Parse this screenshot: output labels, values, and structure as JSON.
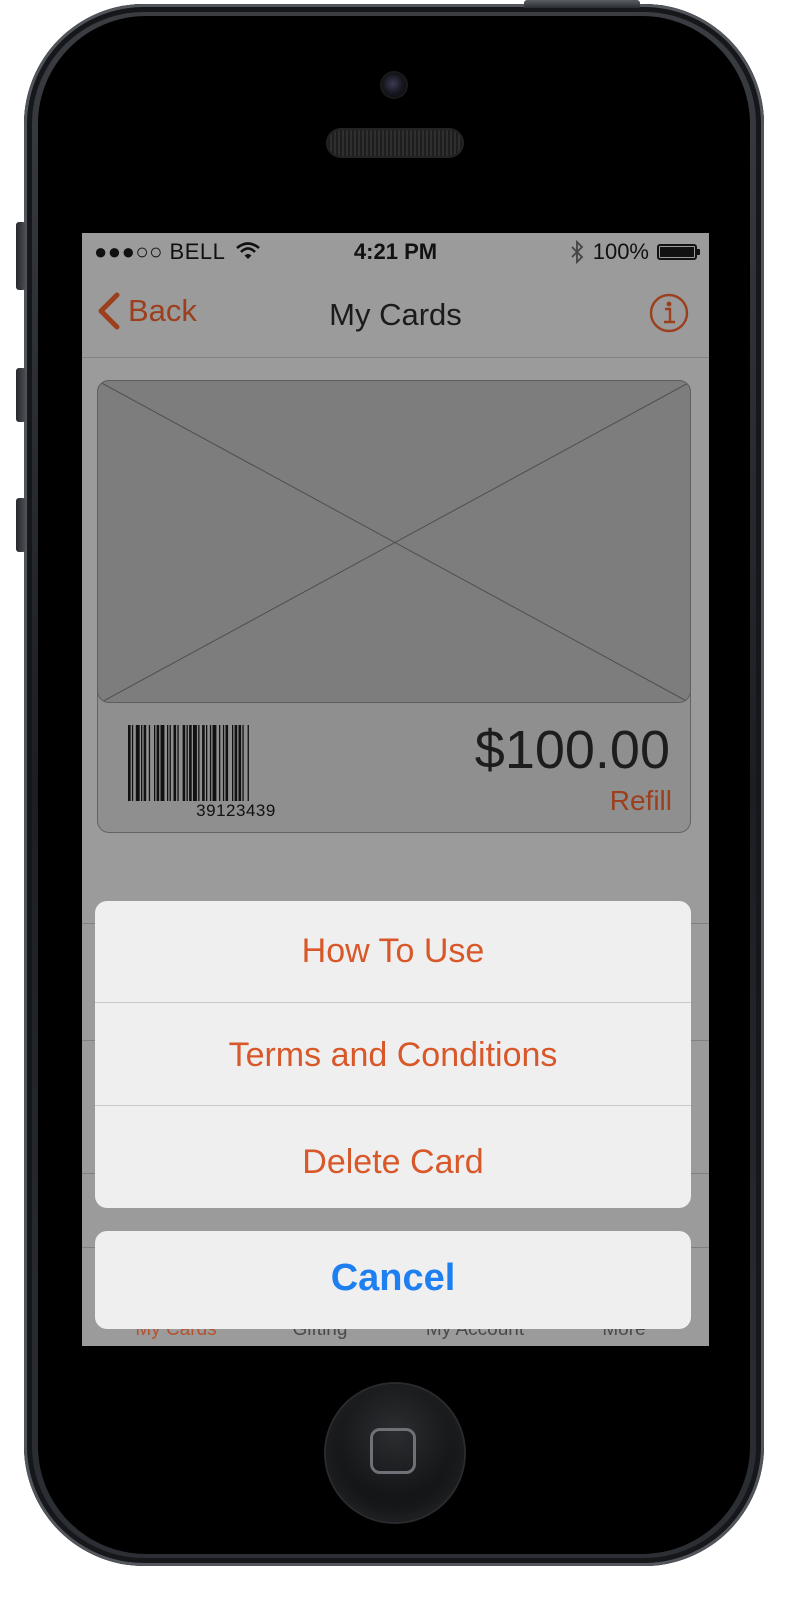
{
  "status_bar": {
    "carrier": "●●●○○ BELL",
    "time": "4:21 PM",
    "battery": "100%",
    "battery_level": 1.0
  },
  "nav": {
    "back_label": "Back",
    "title": "My Cards"
  },
  "card": {
    "barcode_number": "39123439",
    "balance": "$100.00",
    "refill_label": "Refill"
  },
  "tab_bar": {
    "items": [
      {
        "label": "My Cards",
        "selected": true
      },
      {
        "label": "Gifting",
        "selected": false
      },
      {
        "label": "My Account",
        "selected": false
      },
      {
        "label": "More",
        "selected": false
      }
    ]
  },
  "action_sheet": {
    "items": [
      {
        "label": "How To Use"
      },
      {
        "label": "Terms and Conditions"
      },
      {
        "label": "Delete Card"
      }
    ],
    "cancel_label": "Cancel"
  },
  "colors": {
    "accent": "#9b3f1c",
    "action_text": "#d8582a",
    "cancel_text": "#1e7ff0",
    "screen_dim": "#9b9b9b"
  }
}
